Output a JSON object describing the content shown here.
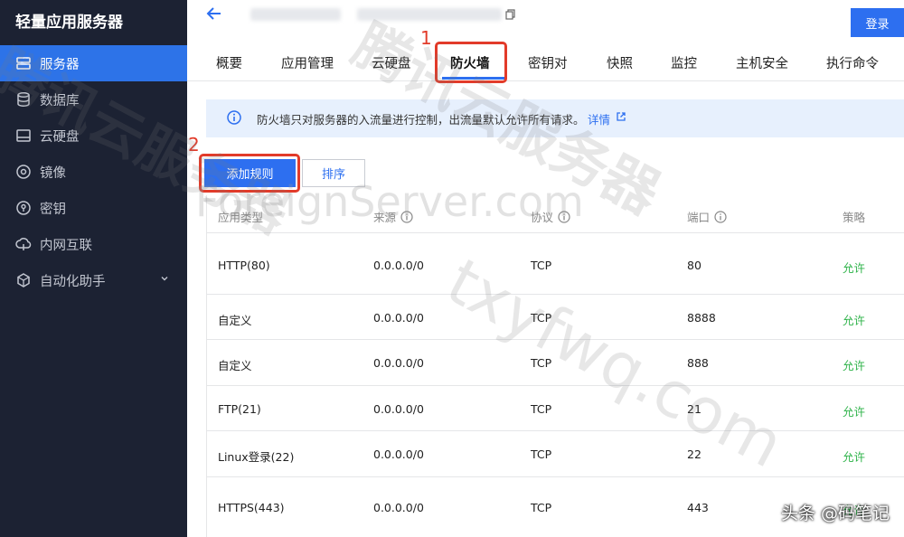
{
  "sidebar": {
    "title": "轻量应用服务器",
    "items": [
      {
        "label": "服务器",
        "icon": "server-icon",
        "active": true
      },
      {
        "label": "数据库",
        "icon": "database-icon"
      },
      {
        "label": "云硬盘",
        "icon": "disk-icon"
      },
      {
        "label": "镜像",
        "icon": "image-icon"
      },
      {
        "label": "密钥",
        "icon": "key-icon"
      },
      {
        "label": "内网互联",
        "icon": "network-icon"
      },
      {
        "label": "自动化助手",
        "icon": "automation-icon"
      }
    ]
  },
  "header": {
    "login_label": "登录"
  },
  "tabs": [
    {
      "label": "概要"
    },
    {
      "label": "应用管理"
    },
    {
      "label": "云硬盘"
    },
    {
      "label": "防火墙",
      "active": true
    },
    {
      "label": "密钥对"
    },
    {
      "label": "快照"
    },
    {
      "label": "监控"
    },
    {
      "label": "主机安全"
    },
    {
      "label": "执行命令"
    }
  ],
  "annotations": {
    "step1": "1",
    "step2": "2"
  },
  "notice": {
    "text": "防火墙只对服务器的入流量进行控制，出流量默认允许所有请求。",
    "link": "详情"
  },
  "actions": {
    "add_rule": "添加规则",
    "sort": "排序"
  },
  "table": {
    "columns": [
      "应用类型",
      "来源",
      "协议",
      "端口",
      "策略"
    ],
    "rows": [
      [
        "HTTP(80)",
        "0.0.0.0/0",
        "TCP",
        "80",
        "允许"
      ],
      [
        "自定义",
        "0.0.0.0/0",
        "TCP",
        "8888",
        "允许"
      ],
      [
        "自定义",
        "0.0.0.0/0",
        "TCP",
        "888",
        "允许"
      ],
      [
        "FTP(21)",
        "0.0.0.0/0",
        "TCP",
        "21",
        "允许"
      ],
      [
        "Linux登录(22)",
        "0.0.0.0/0",
        "TCP",
        "22",
        "允许"
      ],
      [
        "HTTPS(443)",
        "0.0.0.0/0",
        "TCP",
        "443",
        "允许"
      ]
    ]
  },
  "watermarks": {
    "brand_cn": "腾讯云服务器",
    "service_cn": "腾讯云服务器",
    "url": "txyfwq.com",
    "site": "ForeignServer.com"
  },
  "footer": {
    "credit": "头条 @码笔记"
  },
  "colors": {
    "sidebar_bg": "#1c2233",
    "accent": "#2d6ff0",
    "allow": "#2fb34a",
    "highlight": "#e23b2a"
  }
}
